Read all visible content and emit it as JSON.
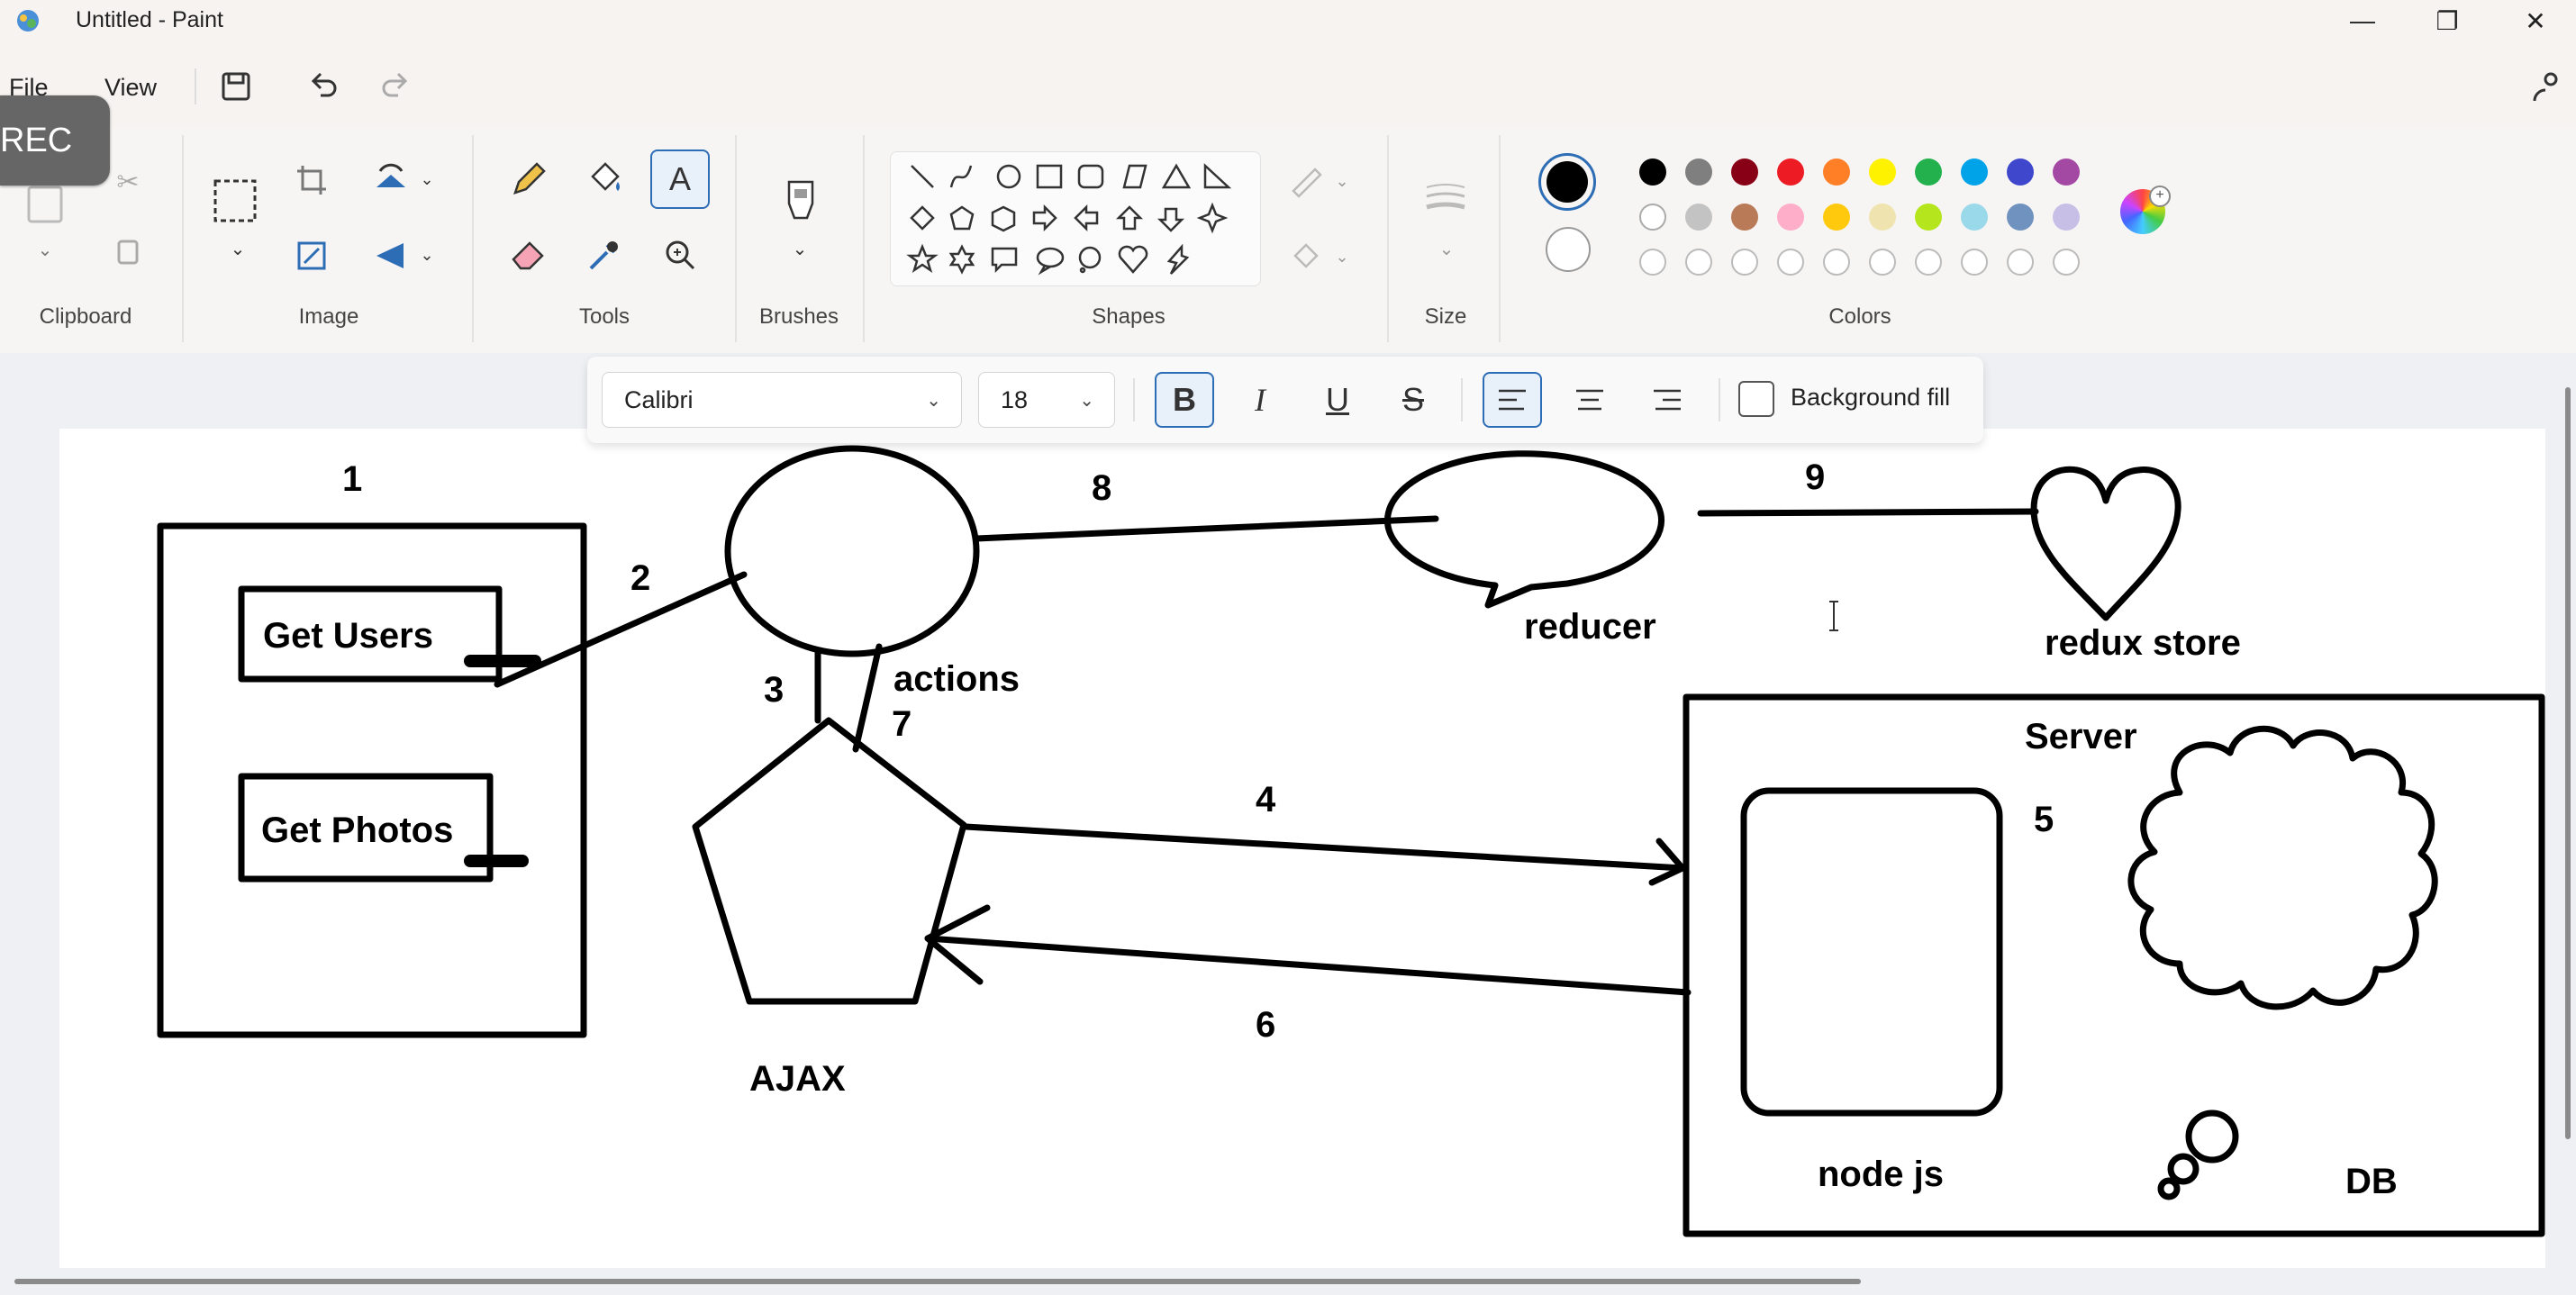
{
  "window": {
    "title": "Untitled - Paint"
  },
  "menu": {
    "file": "File",
    "view": "View"
  },
  "rec": "REC",
  "ribbon": {
    "groups": {
      "clipboard": "Clipboard",
      "image": "Image",
      "tools": "Tools",
      "brushes": "Brushes",
      "shapes": "Shapes",
      "size": "Size",
      "colors": "Colors"
    },
    "primary_color": "#000000",
    "secondary_color": "#ffffff",
    "palette_row1": [
      "#000000",
      "#7f7f7f",
      "#880015",
      "#ed1c24",
      "#ff7f27",
      "#fff200",
      "#22b14c",
      "#00a2e8",
      "#3f48cc",
      "#a349a4"
    ],
    "palette_row2": [
      "#ffffff",
      "#c3c3c3",
      "#b97a57",
      "#ffaec9",
      "#ffc90e",
      "#efe4b0",
      "#b5e61d",
      "#99d9ea",
      "#7092be",
      "#c8bfe7"
    ]
  },
  "text_toolbar": {
    "font": "Calibri",
    "size": "18",
    "background_fill": "Background fill"
  },
  "drawing": {
    "n1": "1",
    "n2": "2",
    "n3": "3",
    "n4": "4",
    "n5": "5",
    "n6": "6",
    "n7": "7",
    "n8": "8",
    "n9": "9",
    "get_users": "Get Users",
    "get_photos": "Get Photos",
    "actions": "actions",
    "ajax": "AJAX",
    "reducer": "reducer",
    "redux_store": "redux store",
    "server": "Server",
    "node_js": "node js",
    "db": "DB"
  }
}
